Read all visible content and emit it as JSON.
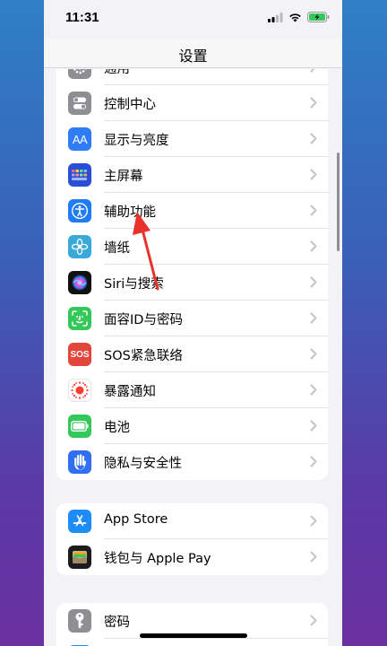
{
  "status_bar": {
    "time": "11:31"
  },
  "nav": {
    "title": "设置"
  },
  "groups": [
    {
      "rows": [
        {
          "label": "通用",
          "icon": "gear-icon",
          "color": "#8e8e93"
        },
        {
          "label": "控制中心",
          "icon": "toggle-switches-icon",
          "color": "#8e8e93"
        },
        {
          "label": "显示与亮度",
          "icon": "text-size-aa-icon",
          "color": "#2f7cf6"
        },
        {
          "label": "主屏幕",
          "icon": "app-grid-icon",
          "color": "#2a4fd6"
        },
        {
          "label": "辅助功能",
          "icon": "accessibility-person-icon",
          "color": "#1f7cf5"
        },
        {
          "label": "墙纸",
          "icon": "flower-icon",
          "color": "#38a9d9"
        },
        {
          "label": "Siri与搜索",
          "icon": "siri-orb-icon",
          "color": "#1a1a2e"
        },
        {
          "label": "面容ID与密码",
          "icon": "face-id-icon",
          "color": "#34c759"
        },
        {
          "label": "SOS紧急联络",
          "icon": "sos-icon",
          "color": "#e2463a"
        },
        {
          "label": "暴露通知",
          "icon": "exposure-dots-icon",
          "color": "#ffffff"
        },
        {
          "label": "电池",
          "icon": "battery-icon",
          "color": "#34c759"
        },
        {
          "label": "隐私与安全性",
          "icon": "hand-icon",
          "color": "#2f6ff0"
        }
      ]
    },
    {
      "rows": [
        {
          "label": "App Store",
          "icon": "app-store-icon",
          "color": "#1d8cf8"
        },
        {
          "label": "钱包与 Apple Pay",
          "icon": "wallet-icon",
          "color": "#1c1c1e"
        }
      ]
    },
    {
      "rows": [
        {
          "label": "密码",
          "icon": "key-icon",
          "color": "#8e8e93"
        },
        {
          "label": "",
          "icon": "mail-icon",
          "color": "#1d8cf8"
        }
      ]
    }
  ],
  "colors": {
    "background": "#f2f2f7",
    "annotation_arrow": "#e8322b",
    "chevron": "#c4c4c7"
  }
}
